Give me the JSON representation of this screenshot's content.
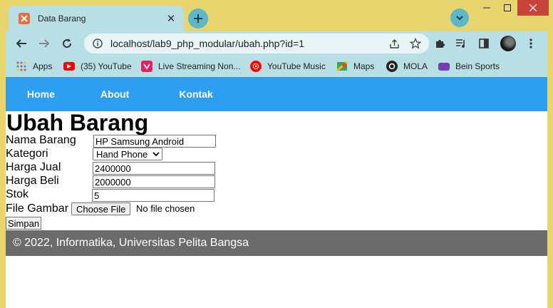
{
  "browser": {
    "tab_title": "Data Barang",
    "url": "localhost/lab9_php_modular/ubah.php?id=1",
    "bookmarks": [
      {
        "label": "Apps",
        "icon": "apps-grid-icon",
        "color": "#e8453c"
      },
      {
        "label": "(35) YouTube",
        "icon": "youtube-icon",
        "color": "#ff0000"
      },
      {
        "label": "Live Streaming Non...",
        "icon": "live-streaming-icon",
        "color": "#e91e63"
      },
      {
        "label": "YouTube Music",
        "icon": "youtube-music-icon",
        "color": "#ff0000"
      },
      {
        "label": "Maps",
        "icon": "maps-icon",
        "color": "#34a853"
      },
      {
        "label": "MOLA",
        "icon": "mola-icon",
        "color": "#222222"
      },
      {
        "label": "Bein Sports",
        "icon": "bein-sports-icon",
        "color": "#6f3fb3"
      }
    ]
  },
  "site_nav": {
    "items": [
      "Home",
      "About",
      "Kontak"
    ]
  },
  "page": {
    "title": "Ubah Barang",
    "form": {
      "nama_barang": {
        "label": "Nama Barang",
        "value": "HP Samsung Android"
      },
      "kategori": {
        "label": "Kategori",
        "value": "Hand Phone"
      },
      "harga_jual": {
        "label": "Harga Jual",
        "value": "2400000"
      },
      "harga_beli": {
        "label": "Harga Beli",
        "value": "2000000"
      },
      "stok": {
        "label": "Stok",
        "value": "5"
      },
      "file_gambar": {
        "label": "File Gambar",
        "button": "Choose File",
        "status": "No file chosen"
      },
      "submit": "Simpan"
    },
    "footer": "© 2022, Informatika, Universitas Pelita Bangsa"
  },
  "colors": {
    "frame": "#e8d56e",
    "browser_bar": "#b8dfe6",
    "site_nav": "#2d9ef0",
    "footer": "#6b6b6b",
    "window_close": "#c8443b"
  }
}
